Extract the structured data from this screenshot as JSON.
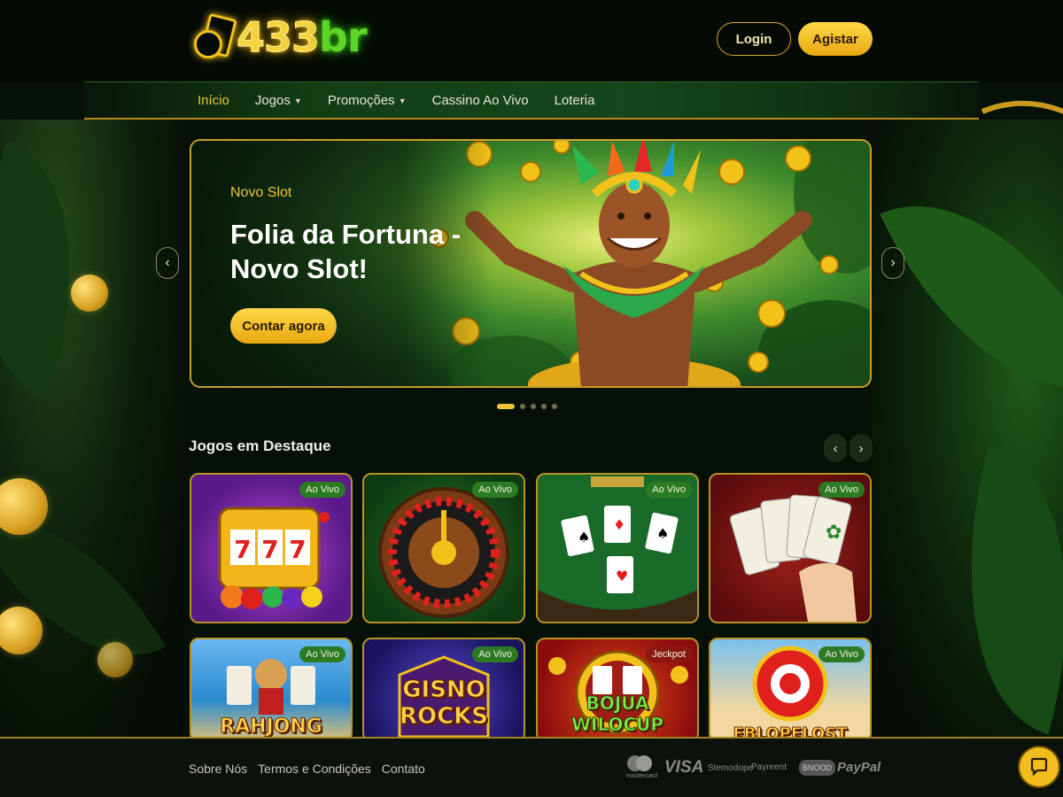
{
  "header": {
    "logo_text_num": "433",
    "logo_text_br": "br",
    "login_label": "Login",
    "register_label": "Agistar"
  },
  "nav": {
    "items": [
      {
        "label": "Início",
        "active": true,
        "dropdown": false
      },
      {
        "label": "Jogos",
        "active": false,
        "dropdown": true
      },
      {
        "label": "Promoções",
        "active": false,
        "dropdown": true
      },
      {
        "label": "Cassino Ao Vivo",
        "active": false,
        "dropdown": false
      },
      {
        "label": "Loteria",
        "active": false,
        "dropdown": false
      }
    ]
  },
  "hero": {
    "subtitle": "Novo Slot",
    "title": "Folia da Fortuna - Novo Slot!",
    "cta": "Contar agora",
    "slides_total": 5,
    "slide_active": 1
  },
  "featured": {
    "title": "Jogos em Destaque",
    "games": [
      {
        "name": "slots-777",
        "badge": "Ao Vivo",
        "label": ""
      },
      {
        "name": "roulette",
        "badge": "Ao Vivo",
        "label": ""
      },
      {
        "name": "blackjack",
        "badge": "Ao Vivo",
        "label": ""
      },
      {
        "name": "mahjong-cards",
        "badge": "Ao Vivo",
        "label": ""
      },
      {
        "name": "mahjong",
        "badge": "Ao Vivo",
        "label": "RAHJONG"
      },
      {
        "name": "gisno-rocks",
        "badge": "Ao Vivo",
        "label": "GISNO ROCKS"
      },
      {
        "name": "bojua-wilocup",
        "badge": "Jeckpot",
        "label": "BOJUA WILOCUP"
      },
      {
        "name": "red-wheel",
        "badge": "Ao Vivo",
        "label": "EBLOPELOST"
      }
    ]
  },
  "footer": {
    "links": [
      "Sobre Nós",
      "Termos e Condições",
      "Contato"
    ],
    "payments": [
      "mastercard",
      "VISA",
      "Stemodope",
      "Payreent",
      "BNOOD",
      "PayPal"
    ]
  },
  "colors": {
    "accent_gold": "#f0c53c",
    "logo_green": "#5ed52a",
    "badge_green": "#2c7a22",
    "badge_red": "#8a1810",
    "background": "#061006"
  }
}
